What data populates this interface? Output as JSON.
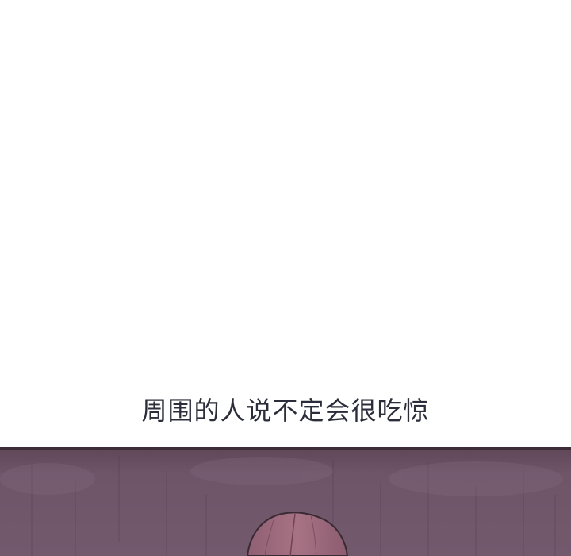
{
  "caption": {
    "text": "周围的人说不定会很吃惊"
  },
  "colors": {
    "caption_text": "#2b2d3a",
    "background_top": "#ffffff",
    "wall_purple": "#6e5568",
    "hair_mauve": "#9a6a7c",
    "outline_dark": "#3a2a33"
  }
}
